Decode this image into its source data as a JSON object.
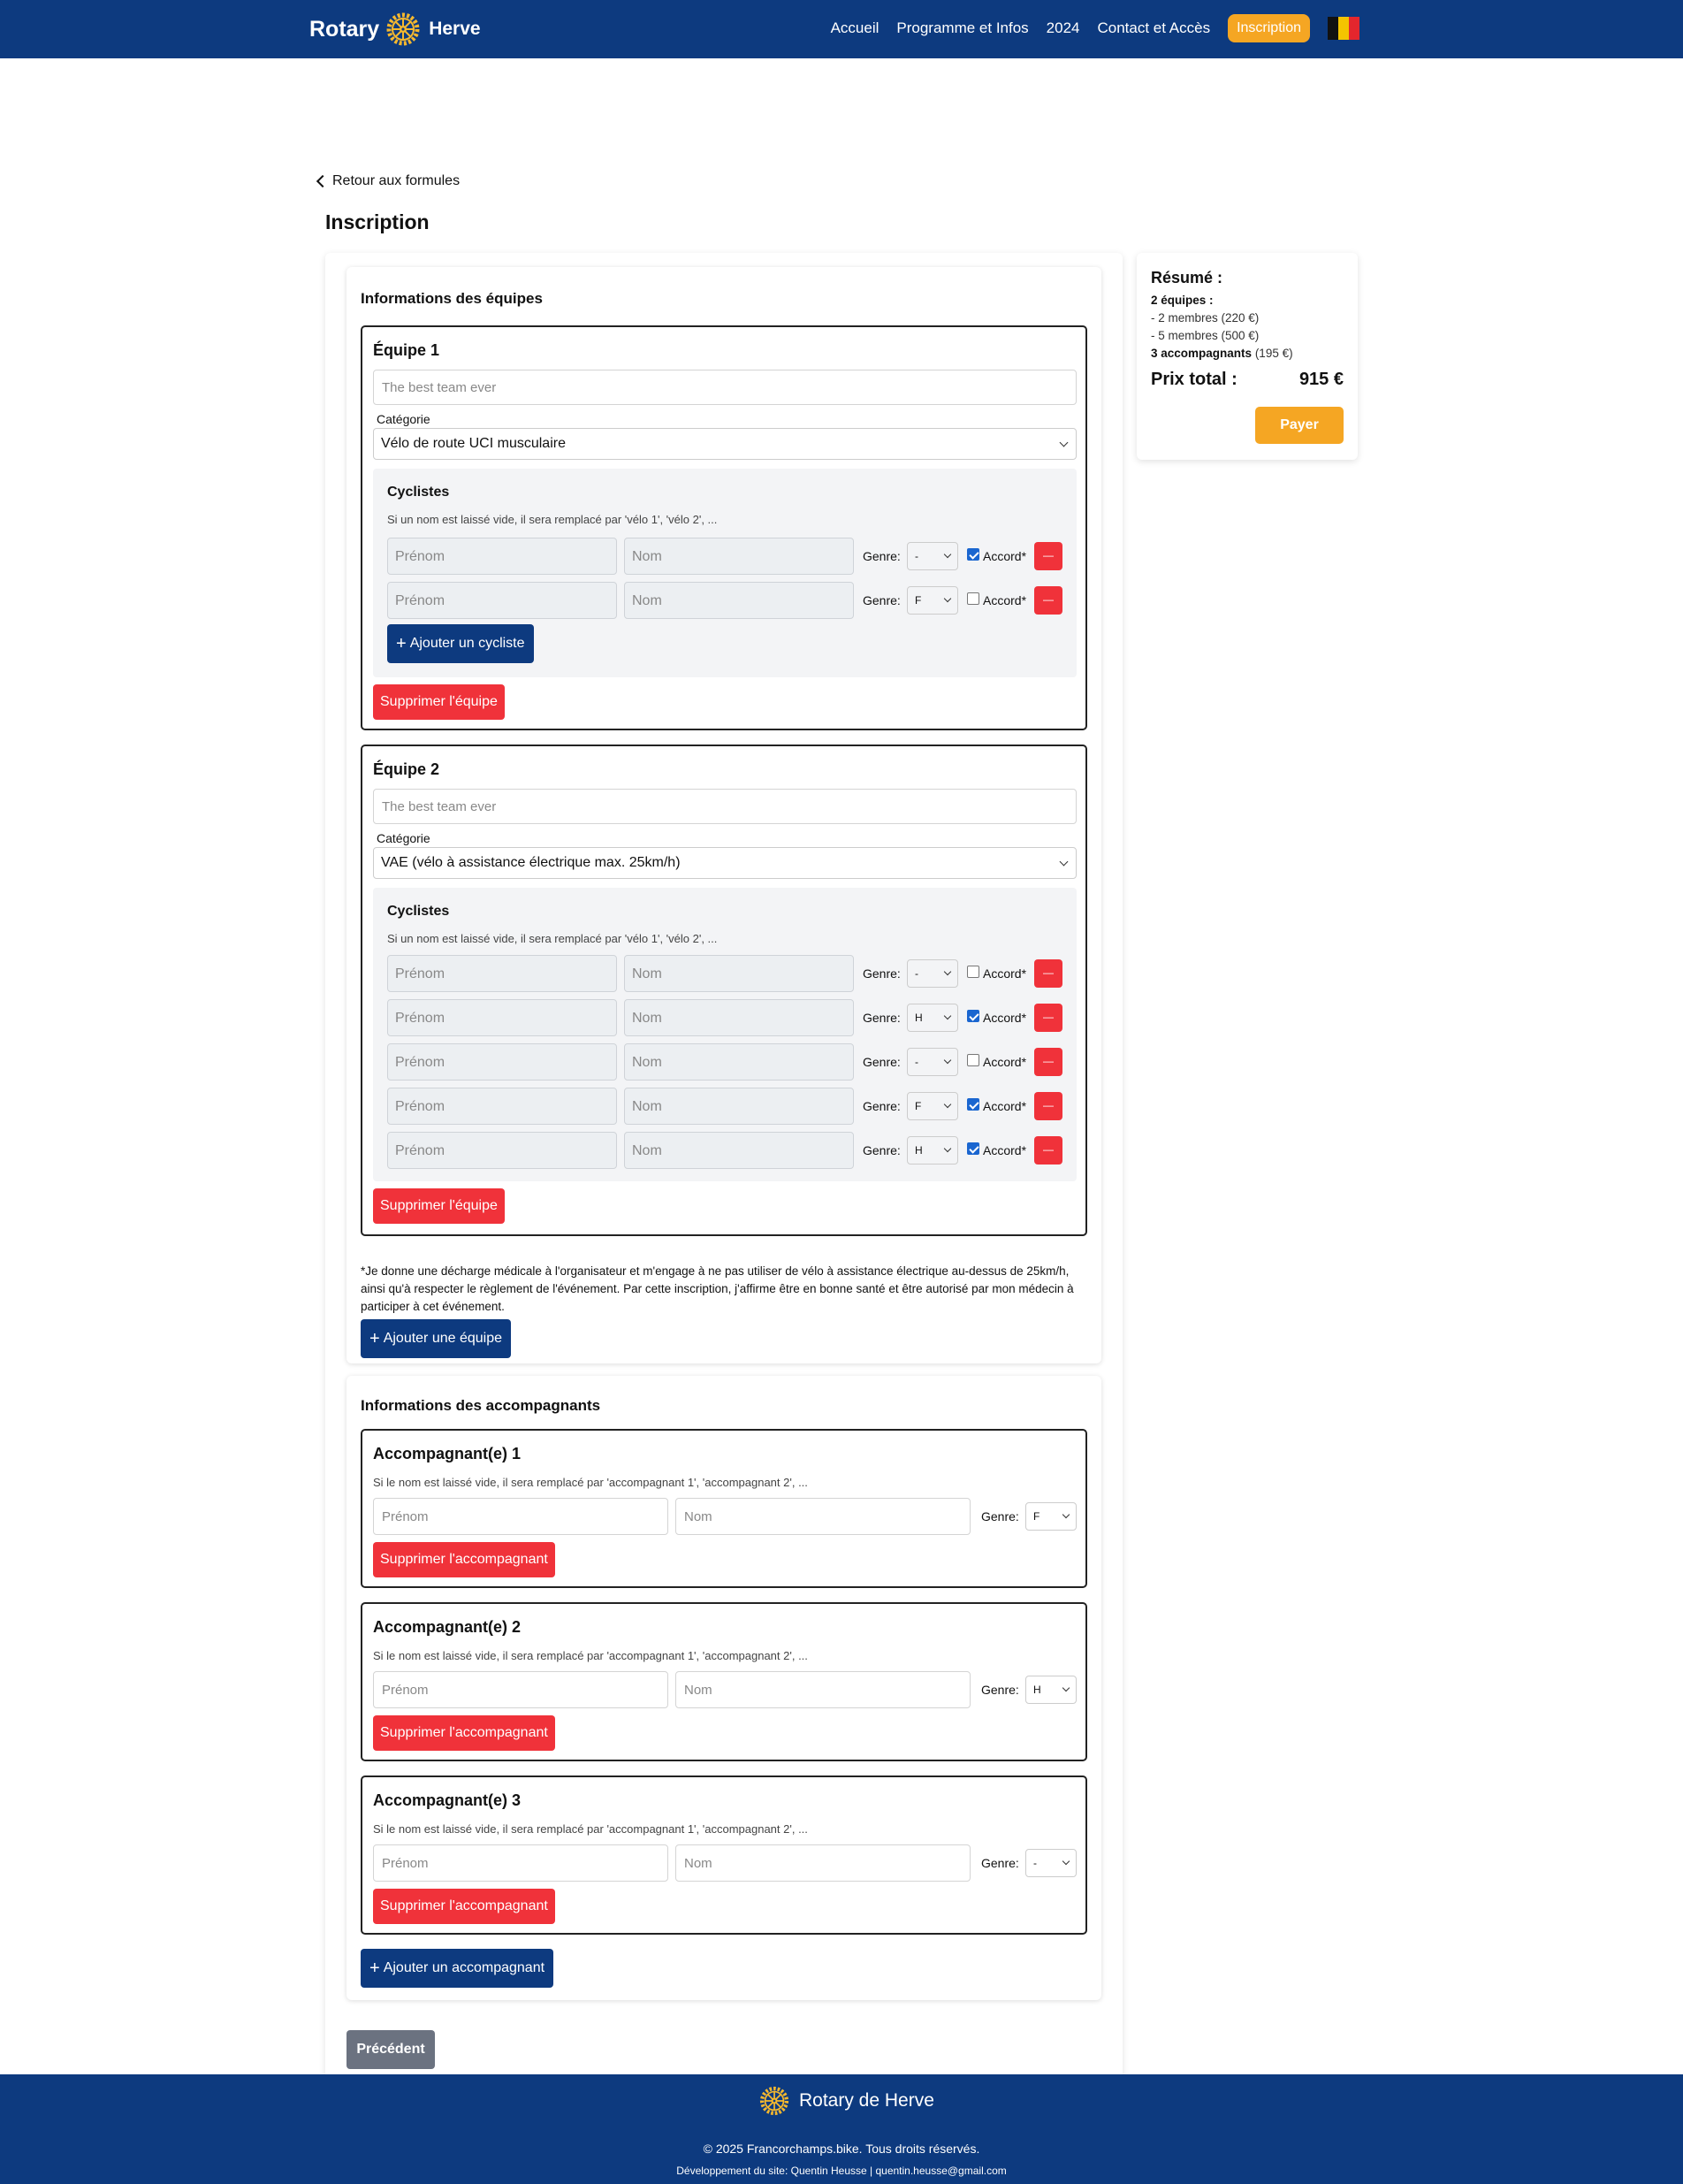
{
  "nav": {
    "brand_left": "Rotary",
    "brand_right": "Herve",
    "links": [
      "Accueil",
      "Programme et Infos",
      "2024",
      "Contact et Accès"
    ],
    "cta": "Inscription",
    "flag_icon": "belgium-flag-icon",
    "colors": {
      "navy": "#0d3a7f",
      "gold": "#f5a623",
      "red": "#f0323a"
    }
  },
  "back_link": "Retour aux formules",
  "page_title": "Inscription",
  "teams_section": {
    "title": "Informations des équipes",
    "category_label": "Catégorie",
    "team_name_placeholder": "The best team ever",
    "cyclists_title": "Cyclistes",
    "cyclists_hint": "Si un nom est laissé vide, il sera remplacé par 'vélo 1', 'vélo 2', ...",
    "first_name_placeholder": "Prénom",
    "last_name_placeholder": "Nom",
    "genre_label": "Genre:",
    "accord_label": "Accord*",
    "remove_label": "—",
    "add_cyclist": "Ajouter un cycliste",
    "delete_team": "Supprimer l'équipe",
    "teams": [
      {
        "title": "Équipe 1",
        "category": "Vélo de route UCI musculaire",
        "cyclists": [
          {
            "genre": "-",
            "accord": true
          },
          {
            "genre": "F",
            "accord": false
          }
        ]
      },
      {
        "title": "Équipe 2",
        "category": "VAE (vélo à assistance électrique max. 25km/h)",
        "cyclists": [
          {
            "genre": "-",
            "accord": false
          },
          {
            "genre": "H",
            "accord": true
          },
          {
            "genre": "-",
            "accord": false
          },
          {
            "genre": "F",
            "accord": true
          },
          {
            "genre": "H",
            "accord": true
          }
        ]
      }
    ],
    "disclaimer": "*Je donne une décharge médicale à l'organisateur et m'engage à ne pas utiliser de vélo à assistance électrique au-dessus de 25km/h, ainsi qu'à respecter le règlement de l'événement. Par cette inscription, j'affirme être en bonne santé et être autorisé par mon médecin à participer à cet événement.",
    "add_team": "Ajouter une équipe"
  },
  "companions_section": {
    "title": "Informations des accompagnants",
    "hint": "Si le nom est laissé vide, il sera remplacé par 'accompagnant 1', 'accompagnant 2', ...",
    "first_name_placeholder": "Prénom",
    "last_name_placeholder": "Nom",
    "genre_label": "Genre:",
    "delete_label": "Supprimer l'accompagnant",
    "companions": [
      {
        "title": "Accompagnant(e) 1",
        "genre": "F"
      },
      {
        "title": "Accompagnant(e) 2",
        "genre": "H"
      },
      {
        "title": "Accompagnant(e) 3",
        "genre": "-"
      }
    ],
    "add_companion": "Ajouter un accompagnant"
  },
  "previous_button": "Précédent",
  "summary": {
    "title": "Résumé :",
    "teams_line": "2 équipes :",
    "team_lines": [
      "- 2 membres (220 €)",
      "- 5 membres (500 €)"
    ],
    "companions_bold": "3 accompagnants",
    "companions_price": "(195 €)",
    "total_label": "Prix total :",
    "total_value": "915 €",
    "pay": "Payer"
  },
  "footer": {
    "brand": "Rotary de Herve",
    "copyright": "© 2025 Francorchamps.bike. Tous droits réservés.",
    "developer": "Développement du site: Quentin Heusse | quentin.heusse@gmail.com"
  }
}
